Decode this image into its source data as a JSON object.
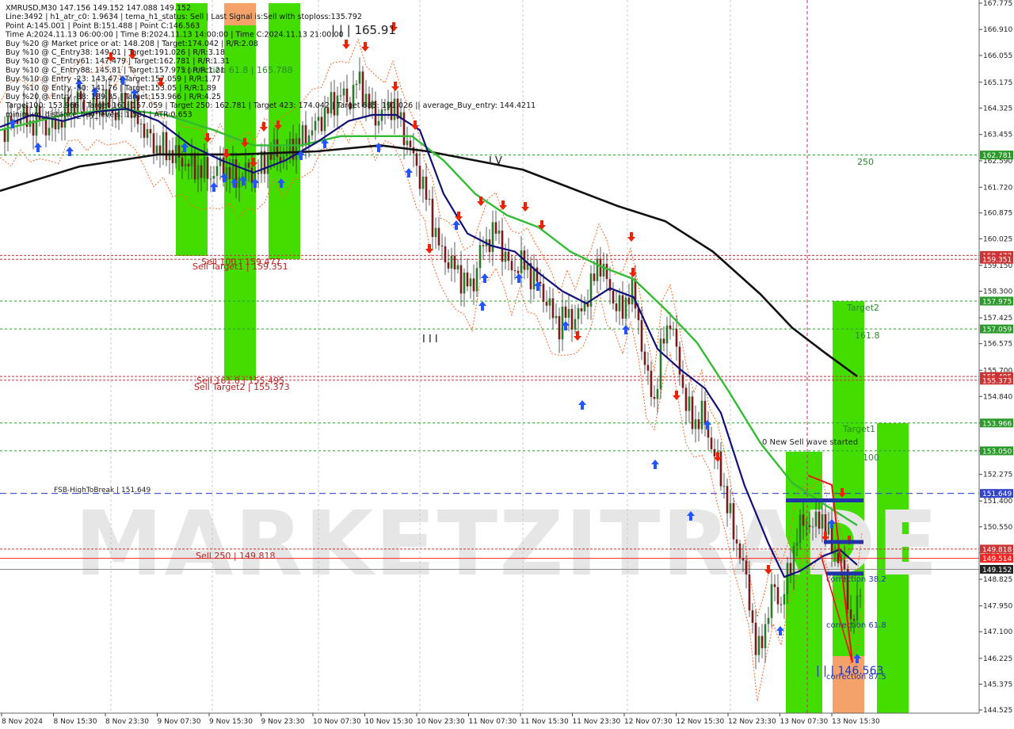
{
  "watermark": "MARKETZITRADE",
  "colors": {
    "green_zone": "#44dd00",
    "orange_zone": "#f4a26a",
    "level_red": "#cc3333",
    "level_green": "#2a9a2a",
    "fsb_blue": "#3344cc",
    "current": "#222222",
    "ma_black": "#111111",
    "ma_green": "#33bb33",
    "ma_blue": "#11117a",
    "envelope": "#ff6622",
    "arrow_up": "#2255ff",
    "arrow_down": "#ee2200",
    "label_green": "#2a8a2a",
    "label_red": "#bb2222",
    "label_blue": "#2233bb",
    "candle_up": "#2a7a2a",
    "candle_down": "#7a1a1a"
  },
  "info_panel": [
    "XMRUSD,M30  147.156 149.152 147.088 149.152",
    "Line:3492 | h1_atr_c0: 1.9634 | tema_h1_status: Sell | Last Signal is:Sell with stoploss:135.792",
    "Point A:145.001 | Point B:151.488 | Point C:146.563",
    "Time A:2024.11.13 06:00:00 | Time B:2024.11.13 14:00:00 | Time C:2024.11.13 21:00:00",
    "Buy %20 @ Market price or at: 148.208 | Target:174.042 | R/R:2.08",
    "Buy %10 @ C_Entry38: 149.01 | Target:191.026 | R/R:3.18",
    "Buy %10 @ C_Entry61: 147.479 | Target:162.781 | R/R:1.31",
    "Buy %10 @ C_Entry88: 145.81 | Target:157.975 | R/R:1.21",
    "Buy %10 @ Entry -23: 143.47 | Target:157.059 | R/R:1.77",
    "Buy %10 @ Entry -50: 141.76 | Target:153.05 | R/R:1.89",
    "Buy %20 @ Entry -88: 139.35 | Target:153.966 | R/R:4.25",
    "Target100: 153.966 | Target 161: 157.059 | Target 250: 162.781 | Target 423: 174.042 | Target 685: 191.026 || average_Buy_entry: 144.4211",
    "minimum_distance_buy_levels: 1.531 | ATR:0.653"
  ],
  "price_axis": {
    "labels": [
      "167.775",
      "166.910",
      "166.055",
      "165.175",
      "164.325",
      "163.455",
      "162.590",
      "161.720",
      "160.875",
      "160.025",
      "159.150",
      "158.300",
      "157.425",
      "156.575",
      "155.700",
      "154.840",
      "153.966",
      "153.050",
      "152.275",
      "151.400",
      "150.550",
      "149.690",
      "148.825",
      "147.950",
      "147.100",
      "146.225",
      "145.375",
      "144.525"
    ],
    "markers": [
      {
        "text": "162.781",
        "color": "#2a9a2a"
      },
      {
        "text": "159.477",
        "color": "#cc3333"
      },
      {
        "text": "159.351",
        "color": "#cc3333"
      },
      {
        "text": "157.975",
        "color": "#2a9a2a"
      },
      {
        "text": "157.059",
        "color": "#2a9a2a"
      },
      {
        "text": "155.495",
        "color": "#cc3333"
      },
      {
        "text": "155.373",
        "color": "#cc3333"
      },
      {
        "text": "153.966",
        "color": "#2a9a2a"
      },
      {
        "text": "153.050",
        "color": "#2a9a2a"
      },
      {
        "text": "151.649",
        "color": "#3344cc"
      },
      {
        "text": "149.818",
        "color": "#cc3333"
      },
      {
        "text": "149.514",
        "color": "#ff2222"
      },
      {
        "text": "149.152",
        "color": "#222222"
      }
    ]
  },
  "time_axis": [
    "8 Nov 2024",
    "8 Nov 15:30",
    "8 Nov 23:30",
    "9 Nov 07:30",
    "9 Nov 15:30",
    "9 Nov 23:30",
    "10 Nov 07:30",
    "10 Nov 15:30",
    "10 Nov 23:30",
    "11 Nov 07:30",
    "11 Nov 15:30",
    "11 Nov 23:30",
    "12 Nov 07:30",
    "12 Nov 15:30",
    "12 Nov 23:30",
    "13 Nov 07:30",
    "13 Nov 15:30"
  ],
  "annotations": {
    "peak_label": "| | | 165.91",
    "wave_iv": "I V",
    "wave_iii": "I I I",
    "low_label": "| | | 146.563",
    "sell_100": "Sell 100 | 159.477",
    "sell_target1": "Sell Target1 | 159.351",
    "sell_1618": "Sell 161.8 | 155.495",
    "sell_target2": "Sell Target2 | 155.373",
    "sell_250": "Sell 250 | 149.818",
    "fsb": "FSB-HighToBreak | 151.649",
    "correction_618_top": "correction 61.8 | 165.788",
    "correction_382": "correction 38.2",
    "correction_618": "correction 61.8",
    "correction_875": "correction 87.5",
    "label_250": "250",
    "label_1618": "161.8",
    "label_100": "100",
    "target2": "Target2",
    "target1": "Target1",
    "new_sell_wave": "0 New Sell wave started"
  },
  "chart_data": [
    {
      "type": "candlestick",
      "symbol": "XMRUSD",
      "timeframe": "M30",
      "ylim": [
        144.4,
        167.8
      ],
      "x_labels": [
        "8 Nov 2024",
        "8 Nov 15:30",
        "8 Nov 23:30",
        "9 Nov 07:30",
        "9 Nov 15:30",
        "9 Nov 23:30",
        "10 Nov 07:30",
        "10 Nov 15:30",
        "10 Nov 23:30",
        "11 Nov 07:30",
        "11 Nov 15:30",
        "11 Nov 23:30",
        "12 Nov 07:30",
        "12 Nov 15:30",
        "12 Nov 23:30",
        "13 Nov 07:30",
        "13 Nov 15:30"
      ],
      "last": {
        "open": 147.156,
        "high": 149.152,
        "low": 147.088,
        "close": 149.152
      },
      "price_path": [
        [
          0,
          163.6
        ],
        [
          14,
          163.8
        ],
        [
          26,
          164.1
        ],
        [
          38,
          163.8
        ],
        [
          50,
          164.0
        ],
        [
          62,
          163.6
        ],
        [
          74,
          163.9
        ],
        [
          86,
          164.3
        ],
        [
          98,
          164.6
        ],
        [
          110,
          164.2
        ],
        [
          122,
          164.4
        ],
        [
          134,
          164.5
        ],
        [
          146,
          164.1
        ],
        [
          158,
          164.6
        ],
        [
          170,
          164.2
        ],
        [
          182,
          163.6
        ],
        [
          194,
          163.1
        ],
        [
          206,
          163.0
        ],
        [
          218,
          162.8
        ],
        [
          230,
          162.6
        ],
        [
          242,
          162.4
        ],
        [
          254,
          162.3
        ],
        [
          266,
          162.1
        ],
        [
          278,
          162.4
        ],
        [
          290,
          162.2
        ],
        [
          300,
          162.0
        ],
        [
          312,
          162.3
        ],
        [
          322,
          162.1
        ],
        [
          334,
          162.6
        ],
        [
          346,
          162.9
        ],
        [
          358,
          162.7
        ],
        [
          370,
          163.1
        ],
        [
          382,
          163.3
        ],
        [
          394,
          163.6
        ],
        [
          406,
          164.0
        ],
        [
          418,
          164.4
        ],
        [
          430,
          164.8
        ],
        [
          440,
          164.5
        ],
        [
          452,
          165.3
        ],
        [
          462,
          164.6
        ],
        [
          474,
          164.0
        ],
        [
          486,
          164.2
        ],
        [
          496,
          164.5
        ],
        [
          506,
          163.8
        ],
        [
          516,
          163.1
        ],
        [
          526,
          162.4
        ],
        [
          536,
          161.6
        ],
        [
          546,
          160.6
        ],
        [
          556,
          159.6
        ],
        [
          566,
          159.3
        ],
        [
          576,
          159.0
        ],
        [
          586,
          158.6
        ],
        [
          596,
          158.4
        ],
        [
          606,
          159.6
        ],
        [
          616,
          160.0
        ],
        [
          626,
          160.3
        ],
        [
          636,
          159.6
        ],
        [
          646,
          158.9
        ],
        [
          656,
          159.3
        ],
        [
          666,
          159.0
        ],
        [
          676,
          158.7
        ],
        [
          686,
          158.2
        ],
        [
          696,
          157.6
        ],
        [
          706,
          157.2
        ],
        [
          716,
          157.6
        ],
        [
          726,
          157.3
        ],
        [
          736,
          157.8
        ],
        [
          746,
          158.4
        ],
        [
          756,
          159.4
        ],
        [
          766,
          158.6
        ],
        [
          776,
          157.9
        ],
        [
          786,
          157.6
        ],
        [
          796,
          158.5
        ],
        [
          806,
          157.3
        ],
        [
          816,
          155.5
        ],
        [
          826,
          154.7
        ],
        [
          836,
          156.6
        ],
        [
          846,
          157.4
        ],
        [
          856,
          156.0
        ],
        [
          866,
          154.6
        ],
        [
          876,
          153.9
        ],
        [
          886,
          154.3
        ],
        [
          896,
          153.4
        ],
        [
          906,
          152.6
        ],
        [
          916,
          151.6
        ],
        [
          926,
          150.3
        ],
        [
          936,
          149.6
        ],
        [
          946,
          148.1
        ],
        [
          956,
          146.2
        ],
        [
          966,
          147.3
        ],
        [
          976,
          148.6
        ],
        [
          986,
          148.0
        ],
        [
          996,
          149.1
        ],
        [
          1006,
          150.3
        ],
        [
          1016,
          150.8
        ],
        [
          1026,
          150.5
        ],
        [
          1036,
          151.0
        ],
        [
          1046,
          150.2
        ],
        [
          1056,
          149.6
        ],
        [
          1066,
          149.0
        ],
        [
          1074,
          147.4
        ],
        [
          1082,
          147.8
        ],
        [
          1088,
          149.152
        ]
      ],
      "series": [
        {
          "name": "ma_slow_black",
          "values": [
            [
              0,
              161.6
            ],
            [
              100,
              162.4
            ],
            [
              200,
              162.8
            ],
            [
              300,
              162.8
            ],
            [
              400,
              162.9
            ],
            [
              480,
              163.1
            ],
            [
              540,
              162.9
            ],
            [
              600,
              162.6
            ],
            [
              660,
              162.3
            ],
            [
              720,
              161.7
            ],
            [
              780,
              161.1
            ],
            [
              840,
              160.6
            ],
            [
              900,
              159.6
            ],
            [
              960,
              158.2
            ],
            [
              1000,
              157.1
            ],
            [
              1040,
              156.3
            ],
            [
              1082,
              155.5
            ]
          ]
        },
        {
          "name": "ma_mid_green",
          "values": [
            [
              0,
              163.6
            ],
            [
              80,
              164.1
            ],
            [
              150,
              164.3
            ],
            [
              210,
              164.1
            ],
            [
              270,
              163.6
            ],
            [
              320,
              163.1
            ],
            [
              380,
              163.1
            ],
            [
              430,
              163.4
            ],
            [
              480,
              163.4
            ],
            [
              520,
              163.4
            ],
            [
              560,
              162.6
            ],
            [
              600,
              161.5
            ],
            [
              640,
              160.8
            ],
            [
              680,
              160.4
            ],
            [
              720,
              159.6
            ],
            [
              760,
              159.1
            ],
            [
              800,
              158.7
            ],
            [
              840,
              157.7
            ],
            [
              880,
              156.6
            ],
            [
              920,
              155.0
            ],
            [
              960,
              153.3
            ],
            [
              1000,
              152.0
            ],
            [
              1040,
              151.3
            ],
            [
              1082,
              150.6
            ]
          ]
        },
        {
          "name": "ma_fast_blue",
          "values": [
            [
              0,
              163.7
            ],
            [
              40,
              164.1
            ],
            [
              80,
              163.9
            ],
            [
              120,
              164.2
            ],
            [
              160,
              164.3
            ],
            [
              200,
              163.9
            ],
            [
              240,
              163.1
            ],
            [
              280,
              162.6
            ],
            [
              320,
              162.2
            ],
            [
              360,
              162.6
            ],
            [
              400,
              163.2
            ],
            [
              440,
              163.9
            ],
            [
              470,
              164.1
            ],
            [
              500,
              164.1
            ],
            [
              530,
              163.6
            ],
            [
              560,
              161.5
            ],
            [
              590,
              160.2
            ],
            [
              620,
              159.8
            ],
            [
              650,
              159.6
            ],
            [
              680,
              158.9
            ],
            [
              710,
              158.3
            ],
            [
              740,
              157.9
            ],
            [
              770,
              158.4
            ],
            [
              800,
              158.1
            ],
            [
              830,
              156.4
            ],
            [
              860,
              155.7
            ],
            [
              890,
              155.1
            ],
            [
              910,
              154.3
            ],
            [
              940,
              151.9
            ],
            [
              970,
              150.0
            ],
            [
              990,
              148.9
            ],
            [
              1010,
              149.1
            ],
            [
              1040,
              149.6
            ],
            [
              1060,
              149.8
            ],
            [
              1082,
              149.3
            ]
          ]
        }
      ]
    }
  ]
}
